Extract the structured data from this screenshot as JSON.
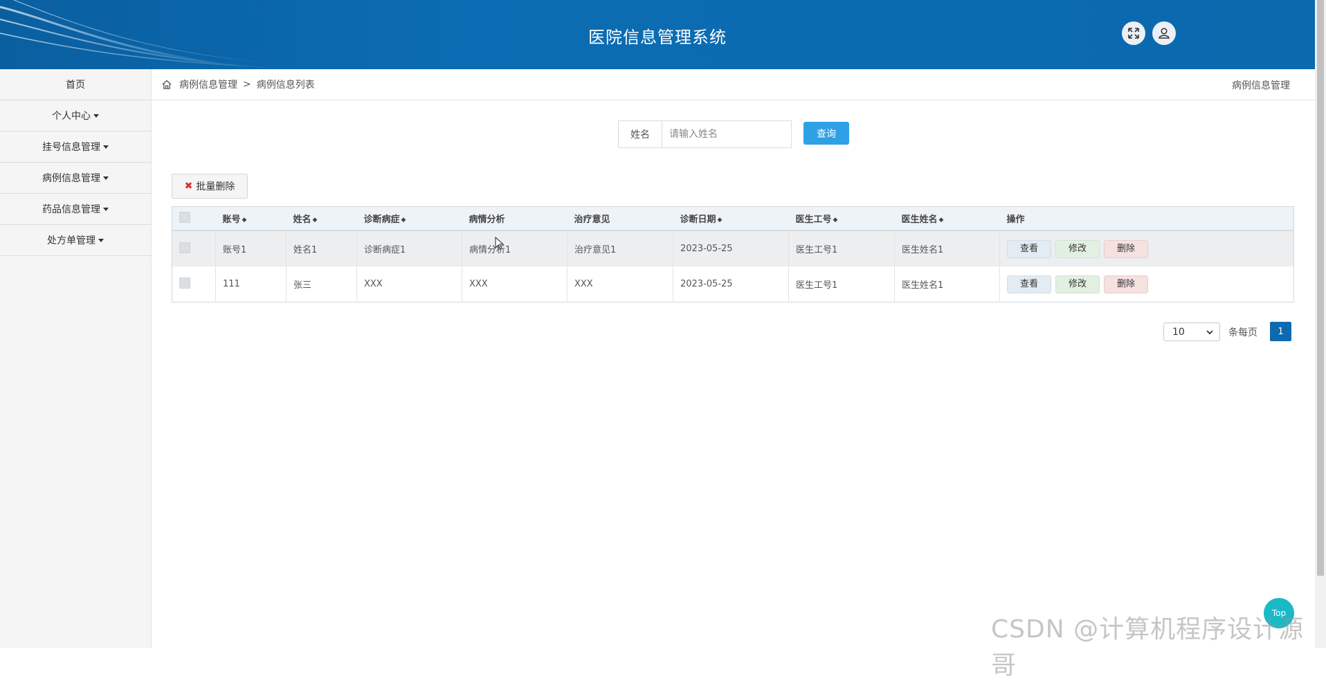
{
  "header": {
    "title": "医院信息管理系统"
  },
  "sidebar": {
    "items": [
      {
        "label": "首页",
        "caret": false
      },
      {
        "label": "个人中心",
        "caret": true
      },
      {
        "label": "挂号信息管理",
        "caret": true
      },
      {
        "label": "病例信息管理",
        "caret": true
      },
      {
        "label": "药品信息管理",
        "caret": true
      },
      {
        "label": "处方单管理",
        "caret": true
      }
    ]
  },
  "breadcrumb": {
    "level1": "病例信息管理",
    "separator": ">",
    "level2": "病例信息列表",
    "right_label": "病例信息管理"
  },
  "search": {
    "label": "姓名",
    "placeholder": "请输入姓名",
    "button": "查询"
  },
  "toolbar": {
    "batch_delete": "批量删除"
  },
  "table": {
    "headers": [
      "账号",
      "姓名",
      "诊断病症",
      "病情分析",
      "治疗意见",
      "诊断日期",
      "医生工号",
      "医生姓名",
      "操作"
    ],
    "rows": [
      [
        "账号1",
        "姓名1",
        "诊断病症1",
        "病情分析1",
        "治疗意见1",
        "2023-05-25",
        "医生工号1",
        "医生姓名1"
      ],
      [
        "111",
        "张三",
        "XXX",
        "XXX",
        "XXX",
        "2023-05-25",
        "医生工号1",
        "医生姓名1"
      ]
    ],
    "actions": {
      "view": "查看",
      "edit": "修改",
      "delete": "删除"
    }
  },
  "pagination": {
    "page_size": "10",
    "per_page_label": "条每页",
    "current_page": "1"
  },
  "top_button": "Top",
  "watermark": "CSDN @计算机程序设计源哥",
  "colors": {
    "header_blue": "#0b6aae",
    "search_button": "#2ea1e6",
    "page_active": "#0d6ab0"
  }
}
